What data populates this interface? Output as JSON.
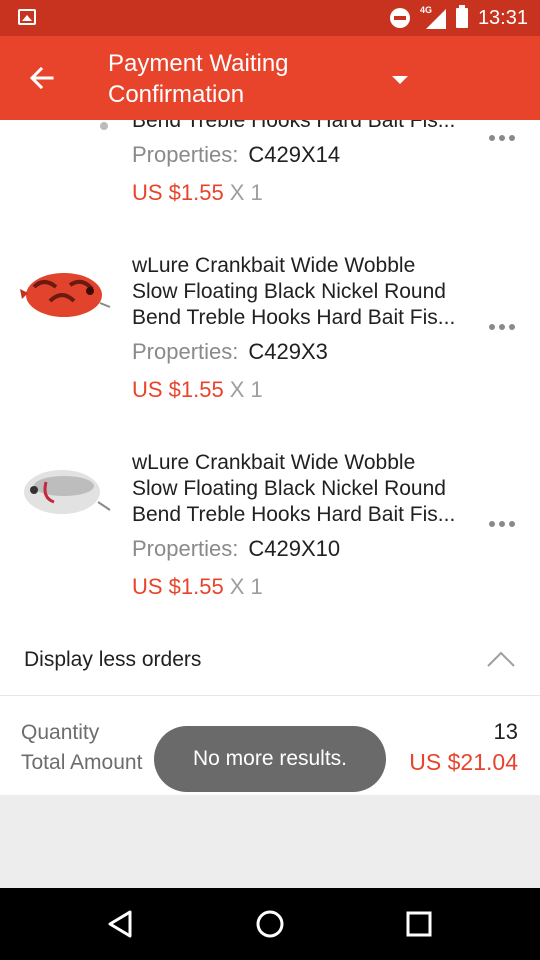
{
  "status_bar": {
    "time": "13:31",
    "network": "4G"
  },
  "app_bar": {
    "title": "Payment Waiting Confirmation"
  },
  "orders": [
    {
      "title_lines": [
        "Bend Treble Hooks Hard Bait Fis..."
      ],
      "properties_label": "Properties:",
      "properties_value": "C429X14",
      "price": "US $1.55",
      "quantity": "X 1"
    },
    {
      "title_lines": [
        "wLure Crankbait Wide Wobble",
        "Slow Floating Black Nickel Round",
        "Bend Treble Hooks Hard Bait Fis..."
      ],
      "properties_label": "Properties:",
      "properties_value": "C429X3",
      "price": "US $1.55",
      "quantity": "X 1",
      "image_icon": "red-crankbait-lure"
    },
    {
      "title_lines": [
        "wLure Crankbait Wide Wobble",
        "Slow Floating Black Nickel Round",
        "Bend Treble Hooks Hard Bait Fis..."
      ],
      "properties_label": "Properties:",
      "properties_value": "C429X10",
      "price": "US $1.55",
      "quantity": "X 1",
      "image_icon": "white-crankbait-lure"
    }
  ],
  "display_less": {
    "label": "Display less orders"
  },
  "summary": {
    "quantity_label": "Quantity",
    "quantity_value": "13",
    "total_label": "Total Amount",
    "total_value": "US $21.04"
  },
  "toast": {
    "text": "No more results."
  },
  "colors": {
    "accent": "#e8442c",
    "status_bar": "#c8331f",
    "price": "#e8442c"
  }
}
